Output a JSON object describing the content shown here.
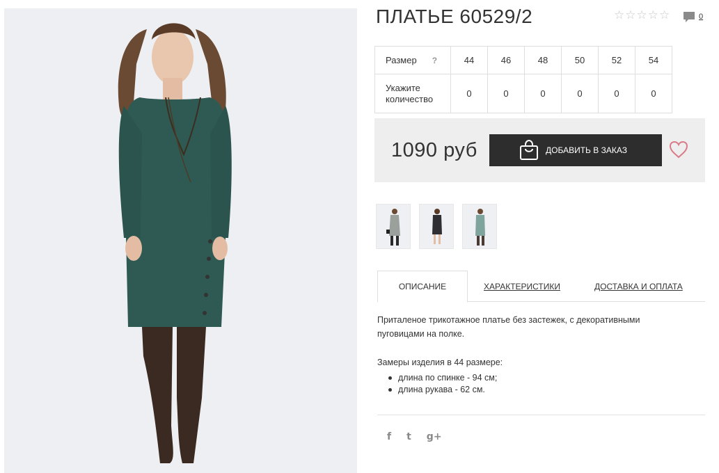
{
  "product": {
    "title": "ПЛАТЬЕ 60529/2",
    "comments_count": "0",
    "rating_stars": 0
  },
  "sizes": {
    "size_label": "Размер",
    "help": "?",
    "values": [
      "44",
      "46",
      "48",
      "50",
      "52",
      "54"
    ],
    "qty_label_line1": "Укажите",
    "qty_label_line2": "количество",
    "quantities": [
      "0",
      "0",
      "0",
      "0",
      "0",
      "0"
    ]
  },
  "order": {
    "price": "1090 руб",
    "add_button": "ДОБАВИТЬ В ЗАКАЗ"
  },
  "tabs": {
    "description": "ОПИСАНИЕ",
    "characteristics": "ХАРАКТЕРИСТИКИ",
    "delivery": "ДОСТАВКА И ОПЛАТА"
  },
  "description": {
    "text": "Приталеное трикотажное платье без застежек, с декоративными пуговицами на полке.",
    "measure_title": "Замеры изделия в 44 размере:",
    "measures": [
      "длина по спинке - 94 см;",
      "длина рукава - 62 см."
    ]
  },
  "social": {
    "facebook": "f",
    "twitter": "t",
    "google": "g+"
  },
  "colors": {
    "dress": "#2f5a54",
    "dark": "#2d2d2d",
    "heart": "#d97a88"
  }
}
